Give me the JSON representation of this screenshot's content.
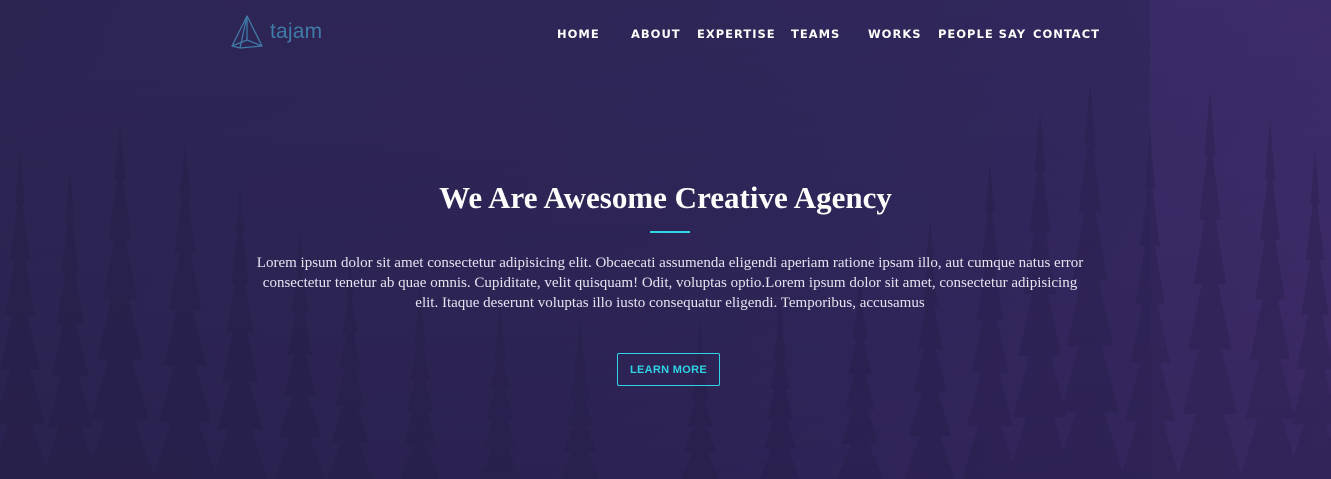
{
  "brand": {
    "name": "tajam",
    "logo_icon": "pyramid-logo-icon"
  },
  "nav": {
    "items": [
      {
        "label": "HOME"
      },
      {
        "label": "ABOUT"
      },
      {
        "label": "EXPERTISE"
      },
      {
        "label": "TEAMS"
      },
      {
        "label": "WORKS"
      },
      {
        "label": "PEOPLE SAY"
      },
      {
        "label": "CONTACT"
      }
    ]
  },
  "hero": {
    "title": "We Are Awesome Creative Agency",
    "body": "Lorem ipsum dolor sit amet consectetur adipisicing elit. Obcaecati assumenda eligendi aperiam ratione ipsam illo, aut cumque natus error consectetur tenetur ab quae omnis. Cupiditate, velit quisquam! Odit, voluptas optio.Lorem ipsum dolor sit amet, consectetur adipisicing elit. Itaque deserunt voluptas illo iusto consequatur eligendi. Temporibus, accusamus",
    "cta_label": "LEARN MORE"
  },
  "colors": {
    "accent": "#2fd4e6",
    "background": "#2b2350",
    "logo": "#3f7aa8"
  }
}
